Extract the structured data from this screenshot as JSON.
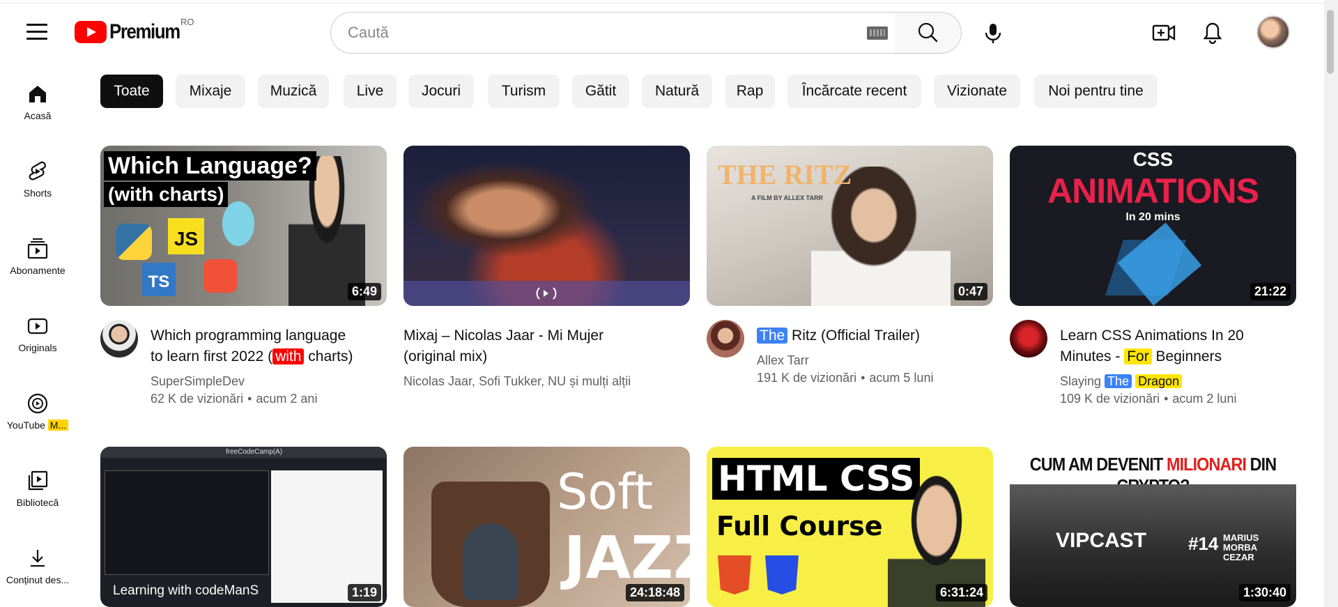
{
  "header": {
    "logo_text": "Premium",
    "country": "RO",
    "search_placeholder": "Caută"
  },
  "sidebar": {
    "items": [
      {
        "label": "Acasă",
        "icon": "home-icon"
      },
      {
        "label": "Shorts",
        "icon": "shorts-icon"
      },
      {
        "label": "Abonamente",
        "icon": "subscriptions-icon"
      },
      {
        "label": "Originals",
        "icon": "originals-icon"
      },
      {
        "label": "YouTube",
        "badge": "M...",
        "icon": "youtube-music-icon"
      },
      {
        "label": "Bibliotecă",
        "icon": "library-icon"
      },
      {
        "label": "Conținut des...",
        "icon": "download-icon"
      }
    ]
  },
  "chips": [
    "Toate",
    "Mixaje",
    "Muzică",
    "Live",
    "Jocuri",
    "Turism",
    "Gătit",
    "Natură",
    "Rap",
    "Încărcate recent",
    "Vizionate",
    "Noi pentru tine"
  ],
  "active_chip": "Toate",
  "videos_row1": [
    {
      "title_a": "Which programming language",
      "title_b": "to learn first 2022 (",
      "title_hl": "with",
      "title_c": " charts)",
      "channel": "SuperSimpleDev",
      "views": "62 K de vizionări",
      "age": "acum 2 ani",
      "duration": "6:49",
      "thumb_title_1": "Which Language?",
      "thumb_title_2": "(with charts)",
      "thumb_js": "JS",
      "thumb_ts": "TS"
    },
    {
      "title_a": "Mixaj – Nicolas Jaar - Mi Mujer",
      "title_b": "(original mix)",
      "channel": "Nicolas Jaar, Sofi Tukker, NU și mulți alții"
    },
    {
      "title_hl": "The",
      "title_a": " Ritz (Official Trailer)",
      "channel": "Allex Tarr",
      "views": "191 K de vizionări",
      "age": "acum 5 luni",
      "duration": "0:47",
      "thumb_title": "THE RITZ",
      "thumb_sub": "A FILM BY ALLEX TARR"
    },
    {
      "title_a": "Learn CSS Animations In 20",
      "title_b": "Minutes - ",
      "title_hl": "For",
      "title_c": " Beginners",
      "channel_a": "Slaying ",
      "channel_hl1": "The",
      "channel_hl2": "Dragon",
      "views": "109 K de vizionări",
      "age": "acum 2 luni",
      "duration": "21:22",
      "thumb_t1": "CSS",
      "thumb_t2": "ANIMATIONS",
      "thumb_t3": "In 20 mins"
    }
  ],
  "videos_row2": [
    {
      "duration": "1:19",
      "thumb_caption": "Learning with codeManS",
      "thumb_app": "freeCodeCamp(A)"
    },
    {
      "duration": "24:18:48",
      "thumb_t1": "Soft",
      "thumb_t2": "JAZZ"
    },
    {
      "duration": "6:31:24",
      "thumb_t1": "HTML CSS",
      "thumb_t2": "Full Course"
    },
    {
      "duration": "1:30:40",
      "thumb_t1a": "CUM AM DEVENIT ",
      "thumb_t1b": "MILIONARI",
      "thumb_t1c": " DIN CRYPTO?",
      "thumb_brand": "VIPCAST",
      "thumb_ep": "#14",
      "thumb_guest": "MARIUS MORBA CEZAR"
    }
  ],
  "colors": {
    "brand": "#ff0000",
    "chip_active": "#0f0f0f",
    "chip_bg": "#f2f2f2",
    "meta_text": "#606060"
  }
}
